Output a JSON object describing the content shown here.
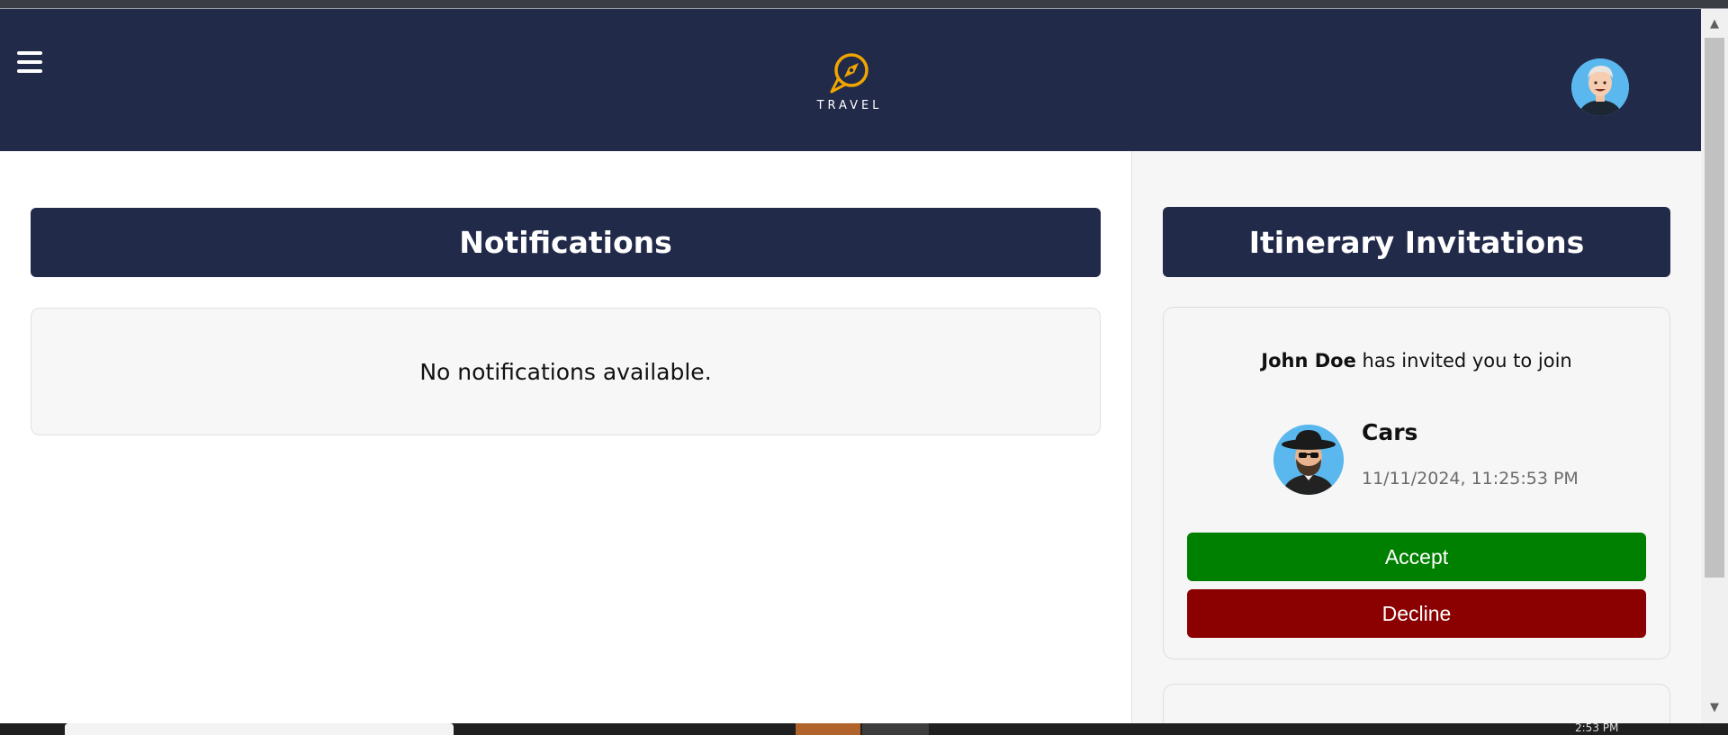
{
  "header": {
    "logo_text": "TRAVEL",
    "menu_icon": "hamburger-menu-icon",
    "profile_icon": "user-avatar"
  },
  "notifications": {
    "title": "Notifications",
    "empty_message": "No notifications available."
  },
  "invitations": {
    "title": "Itinerary Invitations",
    "items": [
      {
        "inviter": "John Doe",
        "message": " has invited you to join",
        "trip_name": "Cars",
        "date": "11/11/2024, 11:25:53 PM",
        "accept_label": "Accept",
        "decline_label": "Decline"
      }
    ]
  },
  "taskbar": {
    "clock": "2:53 PM"
  },
  "colors": {
    "navy": "#222a4a",
    "accent_gold": "#f0a500",
    "accept": "#008000",
    "decline": "#8b0000"
  }
}
